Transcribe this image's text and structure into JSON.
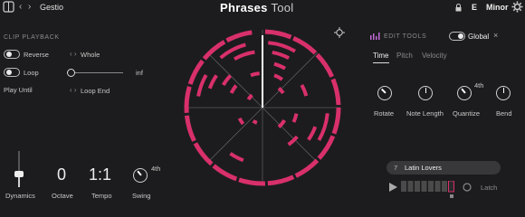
{
  "header": {
    "back_icon": "chevron-left",
    "forward_icon": "chevron-right",
    "project_name": "Gestio",
    "logo_bold": "Phrases",
    "logo_light": "Tool",
    "key_note": "E",
    "key_scale": "Minor"
  },
  "left": {
    "section_title": "CLIP PLAYBACK",
    "reverse_label": "Reverse",
    "loop_label": "Loop",
    "play_until_label": "Play Until",
    "length_value": "Whole",
    "slider_end_label": "inf",
    "play_until_value": "Loop End"
  },
  "bottom_left": {
    "dynamics_label": "Dynamics",
    "octave_value": "0",
    "octave_label": "Octave",
    "tempo_value": "1:1",
    "tempo_label": "Tempo",
    "swing_value": "4th",
    "swing_label": "Swing"
  },
  "right": {
    "section_title": "EDIT TOOLS",
    "global_label": "Global",
    "tabs": [
      "Time",
      "Pitch",
      "Velocity"
    ],
    "quantize_value": "4th",
    "knobs": [
      "Rotate",
      "Note Length",
      "Quantize",
      "Bend"
    ],
    "preset_number": "7",
    "preset_name": "Latin Lovers",
    "latch_label": "Latch"
  },
  "colors": {
    "accent": "#d8306a",
    "background": "#1c1c1e"
  }
}
